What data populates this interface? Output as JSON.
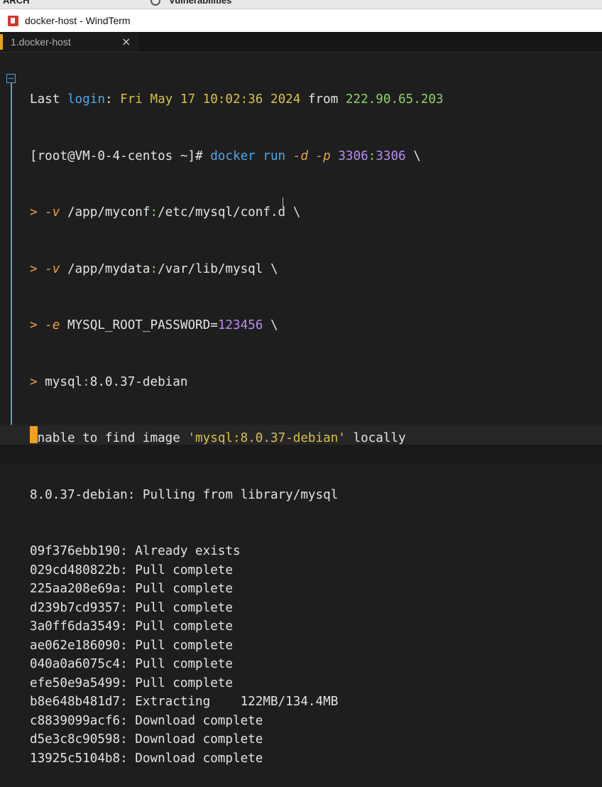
{
  "behind": {
    "left_text": "ARCH",
    "mid_text": "Vulnerabilities"
  },
  "window": {
    "title": "docker-host - WindTerm"
  },
  "tab": {
    "label": "1.docker-host",
    "close": "×"
  },
  "terminal": {
    "last_login": {
      "p1": "Last ",
      "p2": "login",
      "p3": ": ",
      "p4": "Fri May 17 10:02:36 2024",
      "p5": " from ",
      "p6": "222.90.65.203"
    },
    "prompt_line": {
      "p1": "[root@VM-0-4-centos ~]# ",
      "p2": "docker run ",
      "p3": "-d",
      "p4": " ",
      "p5": "-p",
      "p6": " ",
      "p7": "3306",
      "p8": ":",
      "p9": "3306",
      "p10": " \\"
    },
    "cont1": {
      "p1": "> ",
      "p2": "-v",
      "p3": " /app/myconf",
      "p4": ":",
      "p5": "/etc/mysql/conf.d \\"
    },
    "cont2": {
      "p1": "> ",
      "p2": "-v",
      "p3": " /app/mydata",
      "p4": ":",
      "p5": "/var/lib/mysql \\"
    },
    "cont3": {
      "p1": "> ",
      "p2": "-e",
      "p3": " MYSQL_ROOT_PASSWORD=",
      "p4": "123456",
      "p5": " \\"
    },
    "cont4": {
      "p1": "> ",
      "p2": "mysql",
      "p3": ":",
      "p4": "8.0.37-debian"
    },
    "unable": {
      "p1": "Unable to find image ",
      "p2": "'mysql:8.0.37-debian'",
      "p3": " locally"
    },
    "pulling": {
      "p1": "8.0.37-debian",
      "p2": ": Pulling from library/mysql"
    },
    "layers": [
      {
        "id": "09f376ebb190",
        "status": ": Already exists"
      },
      {
        "id": "029cd480822b",
        "status": ": Pull complete"
      },
      {
        "id": "225aa208e69a",
        "status": ": Pull complete"
      },
      {
        "id": "d239b7cd9357",
        "status": ": Pull complete"
      },
      {
        "id": "3a0ff6da3549",
        "status": ": Pull complete"
      },
      {
        "id": "ae062e186090",
        "status": ": Pull complete"
      },
      {
        "id": "040a0a6075c4",
        "status": ": Pull complete"
      },
      {
        "id": "efe50e9a5499",
        "status": ": Pull complete"
      },
      {
        "id": "b8e648b481d7",
        "status": ": Extracting    122MB/134.4MB"
      },
      {
        "id": "c8839099acf6",
        "status": ": Download complete"
      },
      {
        "id": "d5e3c8c90598",
        "status": ": Download complete"
      },
      {
        "id": "13925c5104b8",
        "status": ": Download complete"
      }
    ]
  },
  "colors": {
    "accent": "#e8a317",
    "fold": "#4aa3df",
    "cursor": "#f0a020"
  },
  "icons": [
    "windterm-app-icon",
    "close-icon",
    "fold-icon"
  ]
}
